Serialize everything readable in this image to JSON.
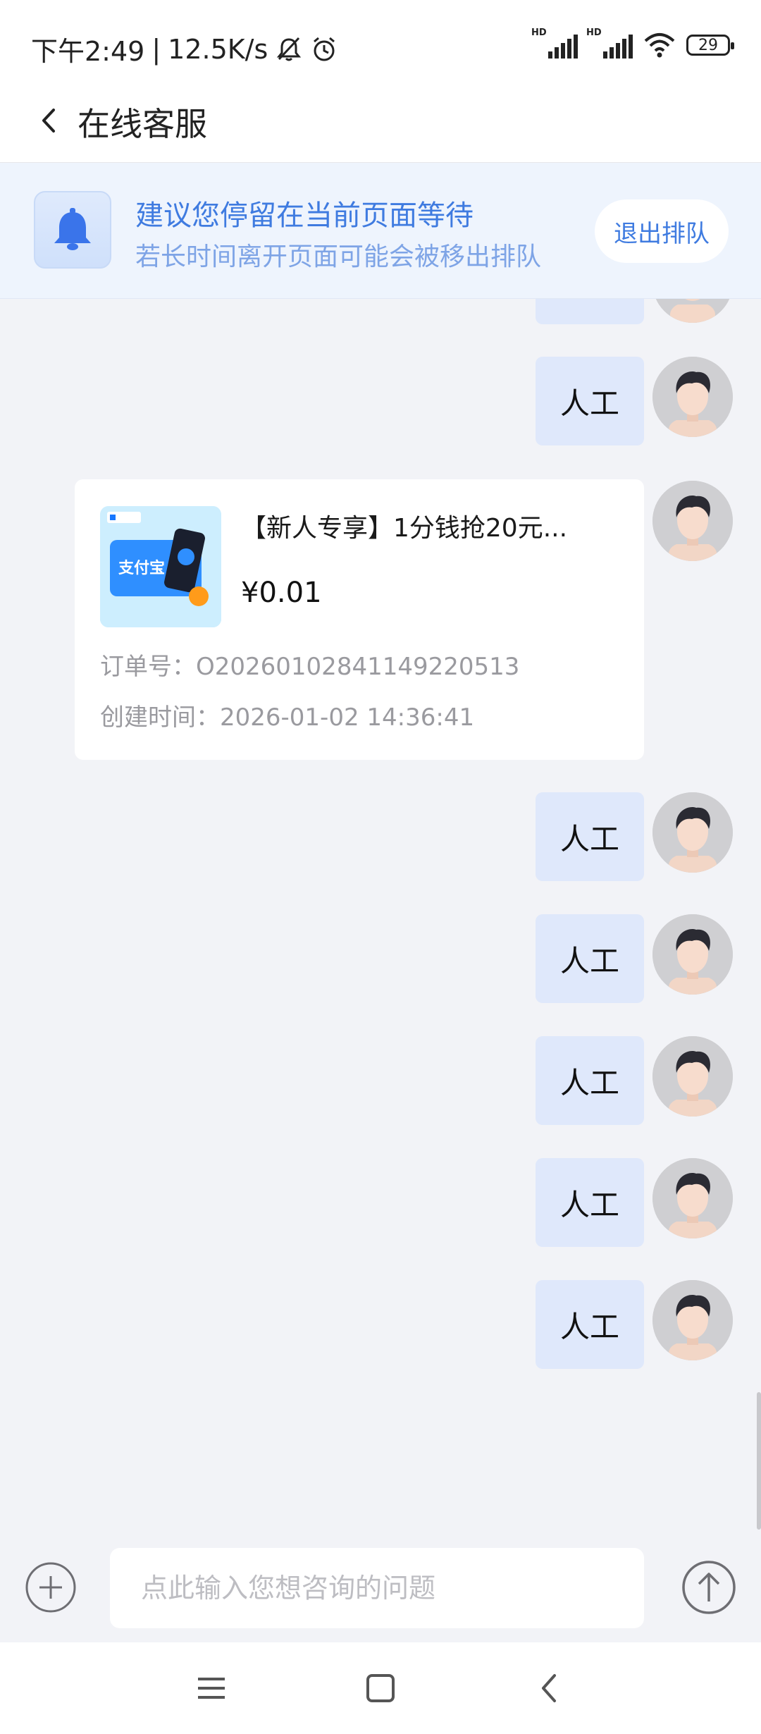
{
  "status_bar": {
    "time": "下午2:49",
    "separator": "|",
    "net_speed": "12.5K/s",
    "battery": "29",
    "signal_1_label": "HD",
    "signal_2_label": "HD"
  },
  "header": {
    "title": "在线客服"
  },
  "notice": {
    "title": "建议您停留在当前页面等待",
    "subtitle": "若长时间离开页面可能会被移出排队",
    "exit_label": "退出排队"
  },
  "messages": [
    {
      "text": "人工"
    },
    {
      "text": "人工"
    },
    {
      "text": "人工"
    },
    {
      "text": "人工"
    },
    {
      "text": "人工"
    },
    {
      "text": "人工"
    }
  ],
  "product_card": {
    "name": "【新人专享】1分钱抢20元...",
    "price": "¥0.01",
    "order_label": "订单号：",
    "order_no": "O20260102841149220513",
    "created_label": "创建时间：",
    "created_time": "2026-01-02 14:36:41",
    "thumb_text": "支付宝"
  },
  "input": {
    "placeholder": "点此输入您想咨询的问题"
  },
  "colors": {
    "accent": "#3f7be0",
    "user_bubble": "#dfe8fb",
    "notice_bg": "#eef4fd",
    "page_bg": "#f2f3f7"
  }
}
